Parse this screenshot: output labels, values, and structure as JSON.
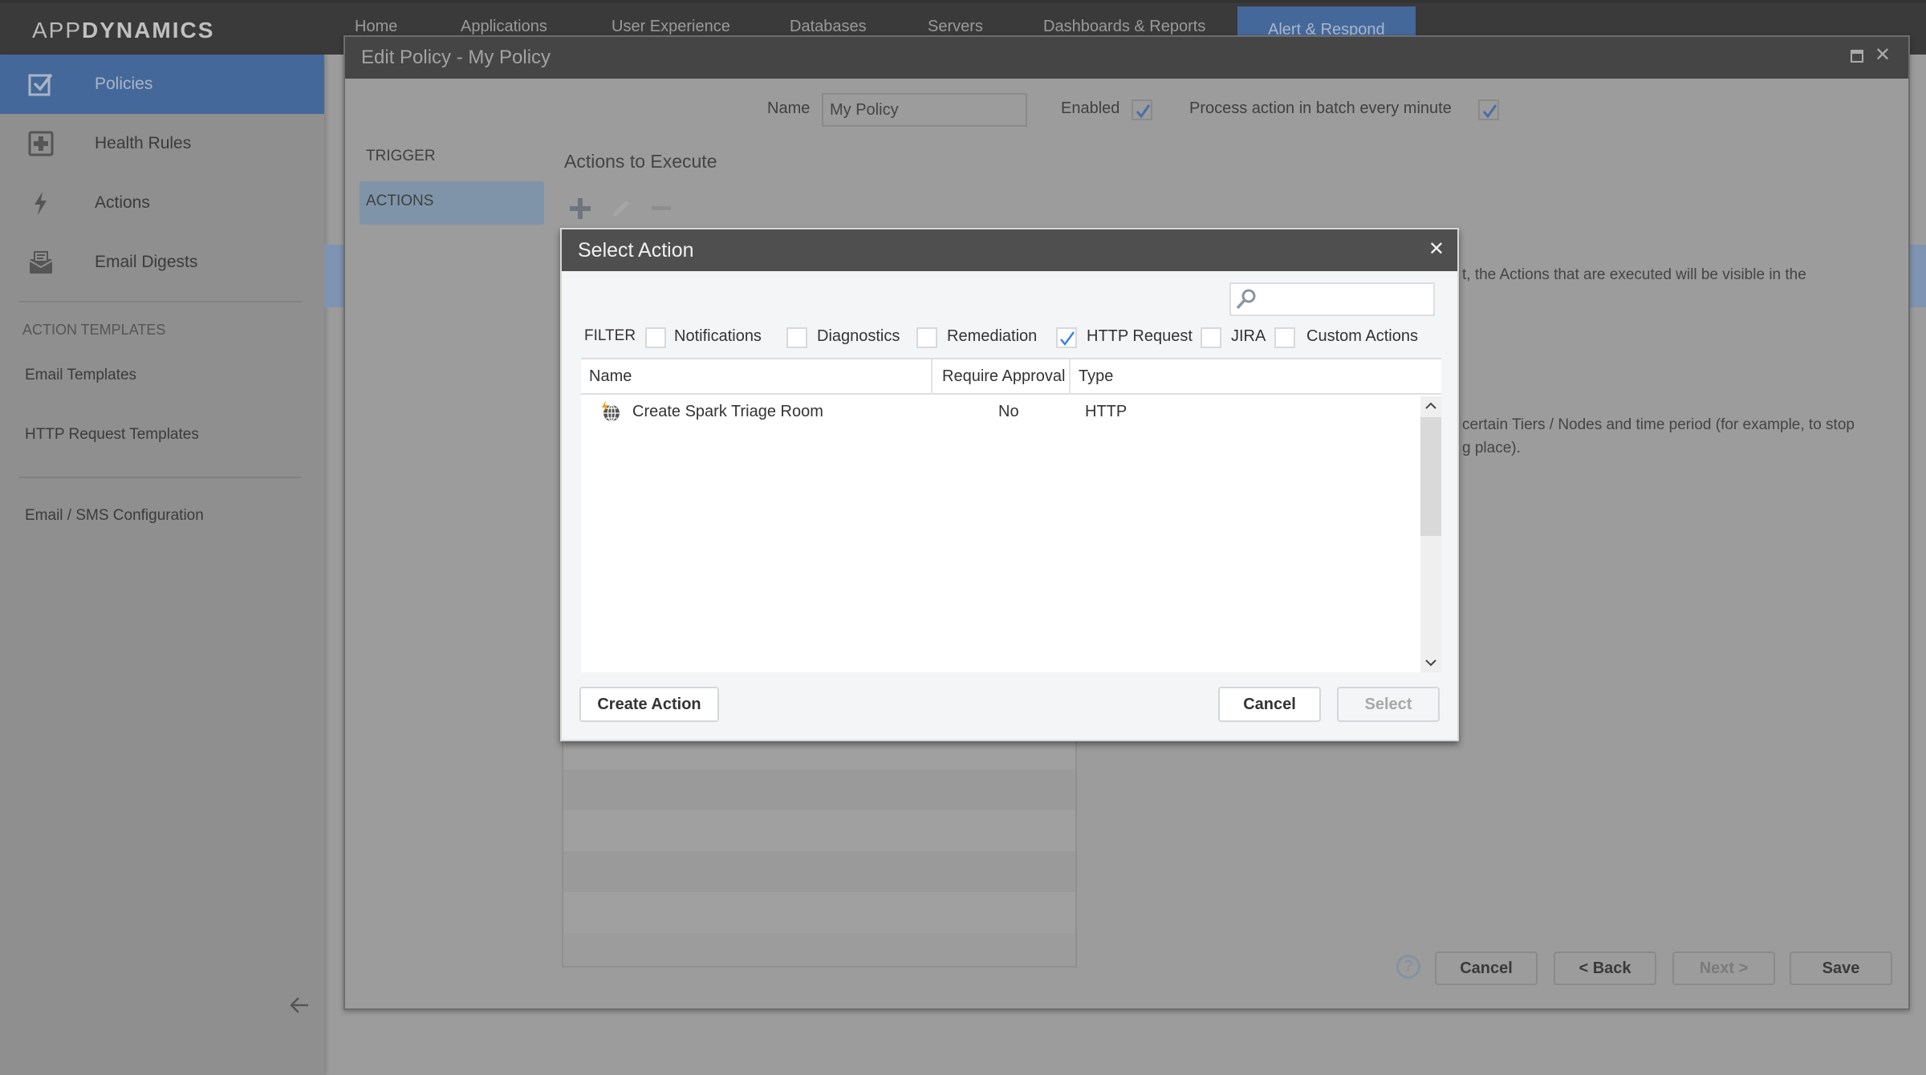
{
  "app": {
    "logo_light": "APP",
    "logo_bold": "DYNAMICS"
  },
  "topnav": {
    "items": [
      {
        "label": "Home"
      },
      {
        "label": "Applications"
      },
      {
        "label": "User Experience"
      },
      {
        "label": "Databases"
      },
      {
        "label": "Servers"
      },
      {
        "label": "Dashboards & Reports"
      },
      {
        "label": "Alert & Respond",
        "active": true
      }
    ]
  },
  "sidebar": {
    "items": [
      {
        "label": "Policies",
        "icon": "checkbox-icon",
        "active": true
      },
      {
        "label": "Health Rules",
        "icon": "plus-square-icon"
      },
      {
        "label": "Actions",
        "icon": "lightning-icon"
      },
      {
        "label": "Email Digests",
        "icon": "mail-open-icon"
      }
    ],
    "section_title": "ACTION TEMPLATES",
    "templates": [
      {
        "label": "Email Templates"
      },
      {
        "label": "HTTP Request Templates"
      }
    ],
    "config_link": "Email / SMS Configuration",
    "collapse_icon": "arrow-left-icon"
  },
  "edit_policy": {
    "title": "Edit Policy - My Policy",
    "name_label": "Name",
    "name_value": "My Policy",
    "enabled_label": "Enabled",
    "enabled": true,
    "batch_label": "Process action in batch every minute",
    "batch": true,
    "steps": [
      {
        "label": "TRIGGER"
      },
      {
        "label": "ACTIONS",
        "active": true
      }
    ],
    "actions_heading": "Actions to Execute",
    "toolbar": {
      "add": "plus-icon",
      "edit": "pencil-icon",
      "remove": "minus-icon"
    },
    "bg_text_1": "t, the Actions that are executed will be visible in the",
    "bg_text_2": "certain Tiers / Nodes and time period (for example, to stop",
    "bg_text_3": "g place).",
    "buttons": {
      "cancel": "Cancel",
      "back": "< Back",
      "next": "Next >",
      "save": "Save"
    }
  },
  "select_action": {
    "title": "Select Action",
    "search_placeholder": "",
    "filter_label": "FILTER",
    "filters": [
      {
        "label": "Notifications",
        "checked": false
      },
      {
        "label": "Diagnostics",
        "checked": false
      },
      {
        "label": "Remediation",
        "checked": false
      },
      {
        "label": "HTTP Request",
        "checked": true
      },
      {
        "label": "JIRA",
        "checked": false
      },
      {
        "label": "Custom Actions",
        "checked": false
      }
    ],
    "columns": [
      "Name",
      "Require Approval",
      "Type"
    ],
    "rows": [
      {
        "name": "Create Spark Triage Room",
        "require_approval": "No",
        "type": "HTTP",
        "icon": "http-action-icon"
      }
    ],
    "buttons": {
      "create": "Create Action",
      "cancel": "Cancel",
      "select": "Select"
    }
  },
  "colors": {
    "accent": "#45689a",
    "modal_titlebar": "#4f4f4f",
    "overlay_gray": "#9c9c9c"
  }
}
